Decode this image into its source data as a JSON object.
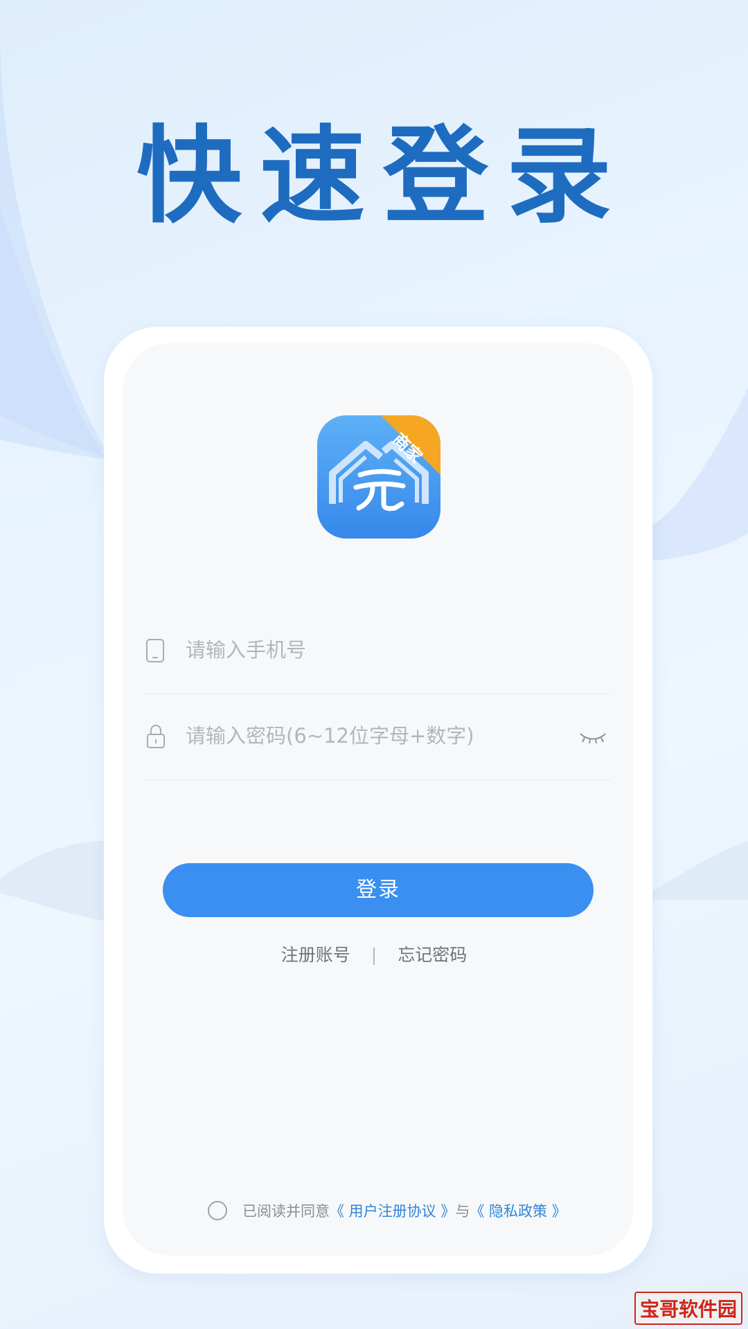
{
  "headline": "快速登录",
  "logo": {
    "badge": "商家",
    "icon": "house-yuan-logo-icon"
  },
  "phone_field": {
    "placeholder": "请输入手机号",
    "icon": "phone-icon"
  },
  "password_field": {
    "placeholder": "请输入密码(6~12位字母+数字)",
    "icon": "lock-icon",
    "toggle_icon": "eye-closed-icon"
  },
  "login_button": {
    "label": "登录"
  },
  "links": {
    "register": "注册账号",
    "divider": "|",
    "forgot": "忘记密码"
  },
  "agreement": {
    "prefix": "已阅读并同意",
    "user_agreement": "《 用户注册协议 》",
    "conjunction": "与",
    "privacy_policy": "《 隐私政策 》"
  },
  "watermark": "宝哥软件园",
  "colors": {
    "accent": "#3a8ff0",
    "headline": "#1e6cbf",
    "badge": "#f5a623",
    "link": "#2f85d8"
  }
}
